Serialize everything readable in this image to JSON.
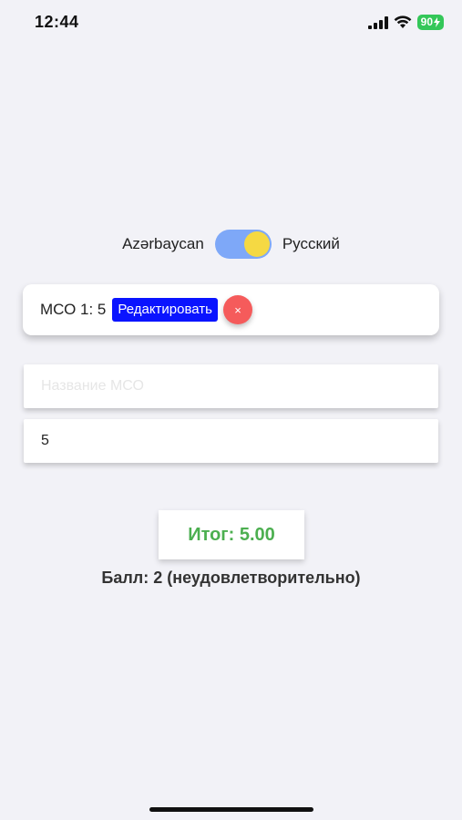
{
  "status_bar": {
    "time": "12:44",
    "battery": "90"
  },
  "language": {
    "left_label": "Azərbaycan",
    "right_label": "Русский"
  },
  "entry": {
    "text": "МСО 1: 5",
    "edit_label": "Редактировать",
    "delete_label": "×"
  },
  "inputs": {
    "name_placeholder": "Название МСО",
    "score_value": "5"
  },
  "result": {
    "total": "Итог: 5.00",
    "grade": "Балл: 2 (неудовлетворительно)"
  },
  "colors": {
    "accent_blue": "#0a14ff",
    "delete_red": "#f55b5b",
    "result_green": "#4caf50",
    "toggle_track": "#7ea8f8",
    "toggle_knob": "#f5d943",
    "battery_green": "#34c759"
  }
}
